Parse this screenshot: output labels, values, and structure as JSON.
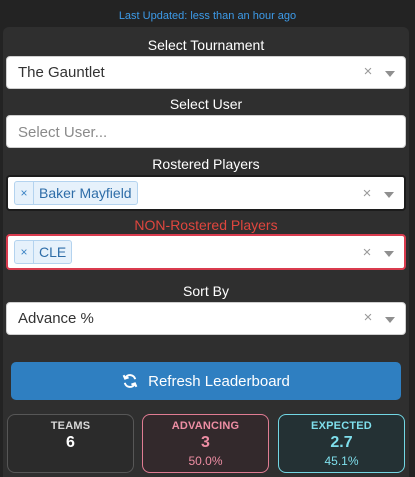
{
  "last_updated": "Last Updated: less than an hour ago",
  "tournament": {
    "label": "Select Tournament",
    "value": "The Gauntlet"
  },
  "user": {
    "label": "Select User",
    "placeholder": "Select User..."
  },
  "rostered": {
    "label": "Rostered Players",
    "tags": [
      "Baker Mayfield"
    ]
  },
  "non_rostered": {
    "label": "NON-Rostered Players",
    "tags": [
      "CLE"
    ]
  },
  "sort": {
    "label": "Sort By",
    "value": "Advance %"
  },
  "refresh_button": {
    "label": "Refresh Leaderboard",
    "icon": "refresh-icon"
  },
  "stats": {
    "teams": {
      "title": "TEAMS",
      "value": "6"
    },
    "advancing": {
      "title": "ADVANCING",
      "value": "3",
      "pct": "50.0%"
    },
    "expected": {
      "title": "EXPECTED",
      "value": "2.7",
      "pct": "45.1%"
    }
  },
  "common": {
    "clear_glyph": "×",
    "remove_glyph": "×"
  },
  "colors": {
    "accent_blue": "#2f7fc1",
    "advancing_pink": "#ee8ea4",
    "expected_cyan": "#7fdfec",
    "non_rostered_red": "#e0463e"
  }
}
